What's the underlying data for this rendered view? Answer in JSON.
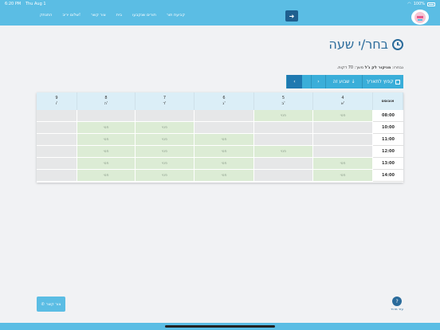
{
  "statusbar": {
    "time": "6:20 PM",
    "date": "Thu Aug 1",
    "battery": "100%"
  },
  "nav": {
    "items": [
      "קביעת תור",
      "תורים שנקבעו",
      "בית",
      "צור קשר",
      "שלום יריב!",
      "התנתק"
    ]
  },
  "page": {
    "title": "בחר/י שעה",
    "selected_prefix": "נבחרו:",
    "selected_service": "מניקור לק ג'ל",
    "selected_duration": "משך: 70 דקות."
  },
  "toolbar": {
    "date_label": "קפוץ לתאריך",
    "week_label": "שבוע זה",
    "prev": "‹",
    "next": "›"
  },
  "calendar": {
    "month": "אוגוסט",
    "days": [
      {
        "num": "4",
        "name": "א'"
      },
      {
        "num": "5",
        "name": "ב'"
      },
      {
        "num": "6",
        "name": "ג'"
      },
      {
        "num": "7",
        "name": "ד'"
      },
      {
        "num": "8",
        "name": "ה'"
      },
      {
        "num": "9",
        "name": "ו'"
      }
    ],
    "times": [
      "08:00",
      "10:00",
      "11:00",
      "12:00",
      "13:00",
      "14:00"
    ],
    "free_label": "פנוי"
  },
  "footer": {
    "contact": "צור קשר",
    "helper": "עזר מהיר"
  },
  "colors": {
    "accent": "#5bbde4",
    "dark": "#2a6b9b",
    "free": "#dcecd5",
    "busy": "#e6e7e8"
  }
}
